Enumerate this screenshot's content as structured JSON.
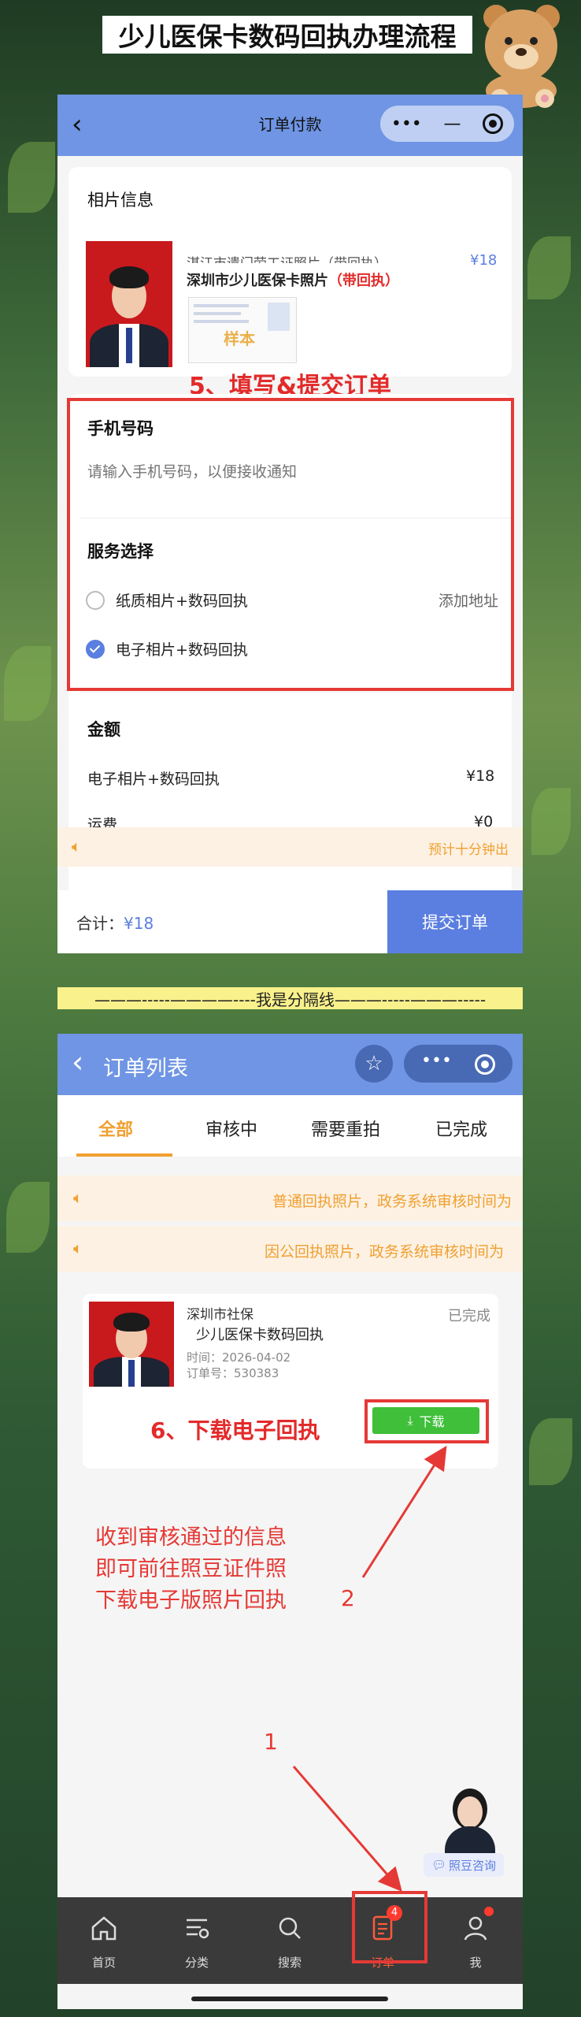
{
  "banner": {
    "title": "少儿医保卡数码回执办理流程"
  },
  "payment_page": {
    "nav_title": "订单付款",
    "capsule_more": "•••",
    "capsule_min": "—",
    "photo_section_title": "相片信息",
    "product_name_behind": "湛江市遗门劳工证照片（带回执）",
    "product_name": "深圳市少儿医保卡照片",
    "product_suffix": "（带回执）",
    "product_price": "¥18",
    "sample_stamp": "样本",
    "step5_label": "5、填写&提交订单",
    "phone_label": "手机号码",
    "phone_placeholder": "请输入手机号码，以便接收通知",
    "service_label": "服务选择",
    "option_paper": "纸质相片+数码回执",
    "add_address": "添加地址",
    "option_digital": "电子相片+数码回执",
    "amount_label": "金额",
    "amount_item": "电子相片+数码回执",
    "amount_item_price": "¥18",
    "shipping_label": "运费",
    "shipping_price": "¥0",
    "eta_text": "预计十分钟出",
    "total_label": "合计：",
    "total_value": "¥18",
    "submit_label": "提交订单"
  },
  "separator": {
    "text": "———-----————----我是分隔线———-----———-----"
  },
  "order_list_page": {
    "nav_title": "订单列表",
    "tabs": [
      "全部",
      "审核中",
      "需要重拍",
      "已完成"
    ],
    "notices": [
      "普通回执照片，政务系统审核时间为",
      "因公回执照片，政务系统审核时间为"
    ],
    "order": {
      "org": "深圳市社保",
      "status": "已完成",
      "title": "少儿医保卡数码回执",
      "time": "时间：2026-04-02",
      "order_no": "订单号：530383",
      "download_label": "下载"
    },
    "step6_label": "6、下载电子回执",
    "instruction_lines": [
      "收到审核通过的信息",
      "即可前往照豆证件照",
      "下载电子版照片回执"
    ],
    "marker_1": "1",
    "marker_2": "2",
    "consult_label": "照豆咨询",
    "tabbar": [
      {
        "label": "首页",
        "icon": "home-icon"
      },
      {
        "label": "分类",
        "icon": "category-icon"
      },
      {
        "label": "搜索",
        "icon": "search-icon"
      },
      {
        "label": "订单",
        "icon": "order-icon",
        "badge": "4"
      },
      {
        "label": "我",
        "icon": "profile-icon"
      }
    ]
  },
  "colors": {
    "nav_blue": "#6f95e4",
    "accent_blue": "#5b7fe0",
    "annotation_red": "#e53935",
    "download_green": "#3fbf3a",
    "orange": "#f0a030"
  }
}
